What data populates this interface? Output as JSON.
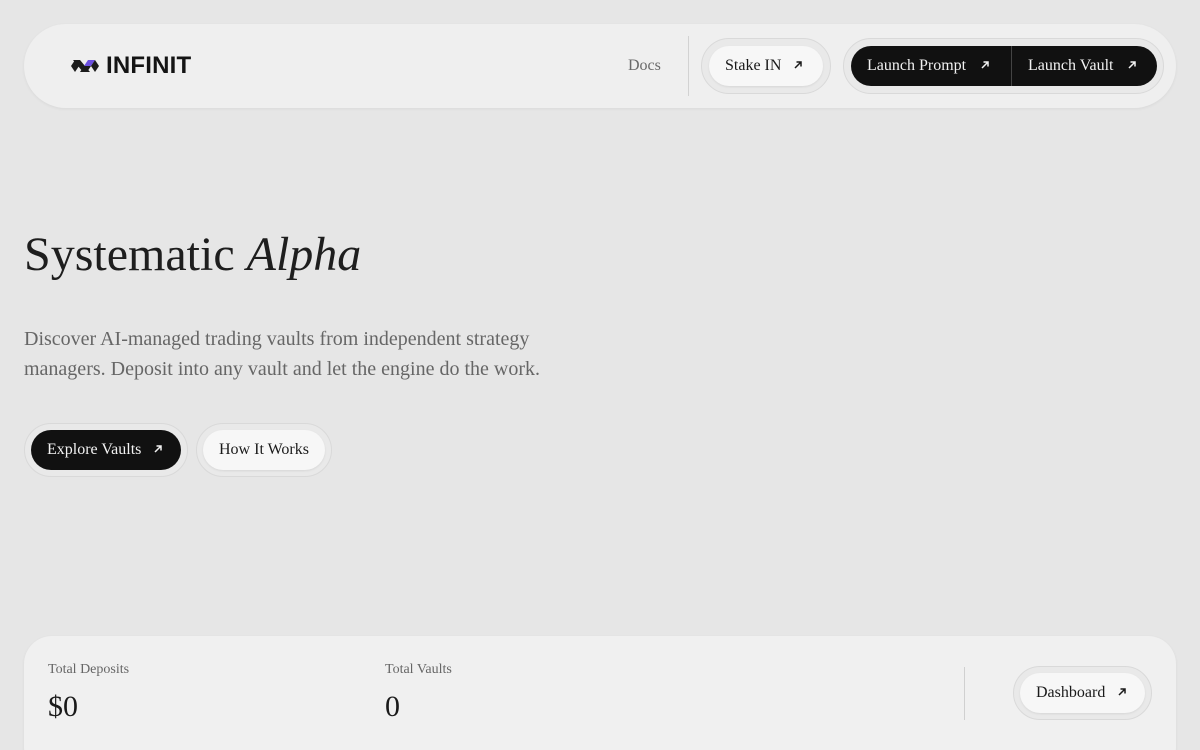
{
  "nav": {
    "brand": "INFINIT",
    "docs_label": "Docs",
    "stake_label": "Stake IN",
    "launch_prompt_label": "Launch Prompt",
    "launch_vault_label": "Launch Vault"
  },
  "hero": {
    "title_plain": "Systematic",
    "title_italic": "Alpha",
    "subtitle": "Discover AI-managed trading vaults from independent strategy managers. Deposit into any vault and let the engine do the work.",
    "explore_label": "Explore Vaults",
    "how_label": "How It Works"
  },
  "stats": {
    "deposits_label": "Total Deposits",
    "deposits_value": "$0",
    "vaults_label": "Total Vaults",
    "vaults_value": "0",
    "dashboard_label": "Dashboard"
  },
  "icons": {
    "logo": "infinit-logo-icon",
    "external": "arrow-up-right-icon"
  },
  "colors": {
    "background": "#e6e6e6",
    "surface": "#efefef",
    "dark_button": "#111111",
    "logo_accent": "#6b4fe0"
  }
}
